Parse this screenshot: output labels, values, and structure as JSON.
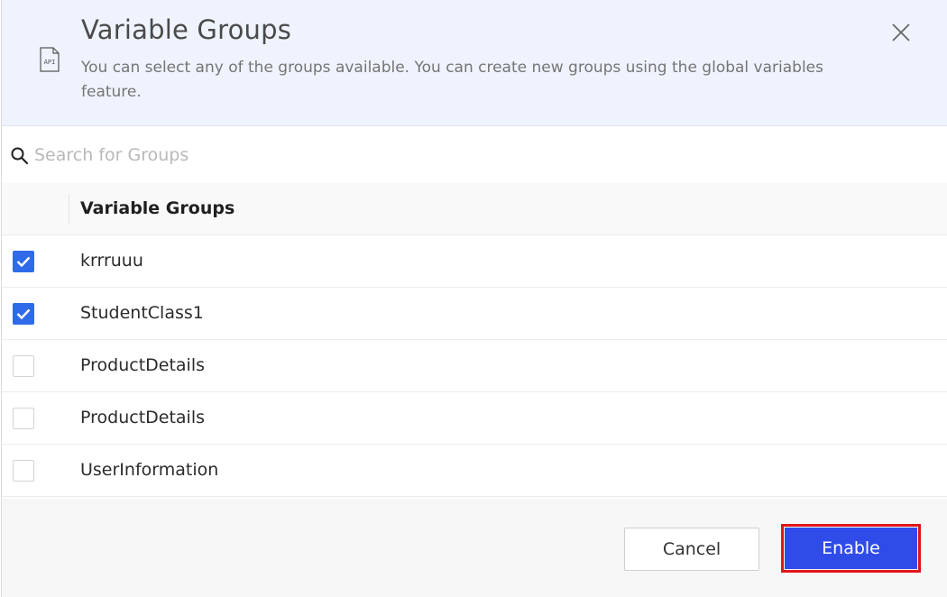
{
  "dialog": {
    "title": "Variable Groups",
    "subtitle": "You can select any of the groups available. You can create new groups using the global variables feature.",
    "api_icon_label": "API"
  },
  "search": {
    "placeholder": "Search for Groups",
    "value": ""
  },
  "table": {
    "column_header": "Variable Groups",
    "rows": [
      {
        "label": "krrruuu",
        "checked": true
      },
      {
        "label": "StudentClass1",
        "checked": true
      },
      {
        "label": "ProductDetails",
        "checked": false
      },
      {
        "label": "ProductDetails",
        "checked": false
      },
      {
        "label": "UserInformation",
        "checked": false
      }
    ]
  },
  "footer": {
    "cancel_label": "Cancel",
    "enable_label": "Enable"
  },
  "colors": {
    "header_bg": "#eef3fd",
    "checkbox_checked": "#2f6be8",
    "enable_button": "#2f4ce8",
    "highlight_border": "#e0151b"
  }
}
